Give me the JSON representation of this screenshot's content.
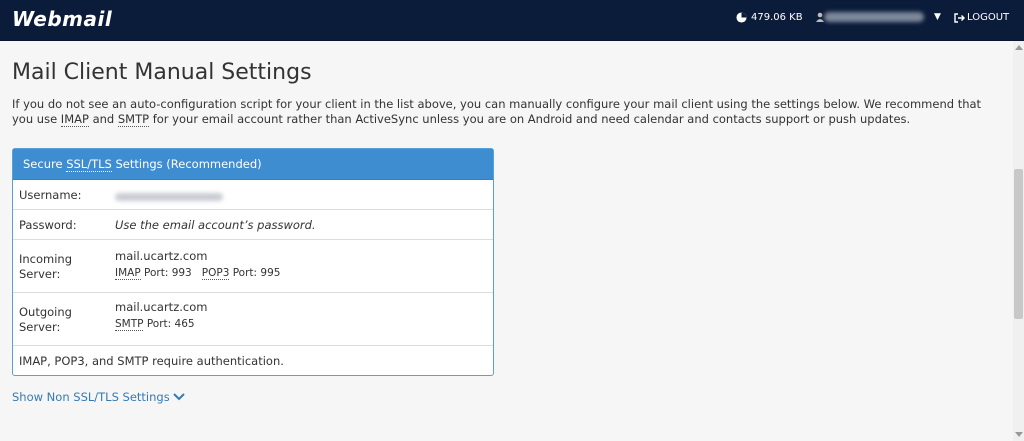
{
  "header": {
    "logo": "Webmail",
    "disk_usage": "479.06 KB",
    "logout_label": "LOGOUT"
  },
  "page": {
    "title": "Mail Client Manual Settings",
    "intro_part1": "If you do not see an auto-configuration script for your client in the list above, you can manually configure your mail client using the settings below. We recommend that you use ",
    "intro_imap": "IMAP",
    "intro_and": " and ",
    "intro_smtp": "SMTP",
    "intro_part2": " for your email account rather than ActiveSync unless you are on Android and need calendar and contacts support or push updates."
  },
  "panel": {
    "title_prefix": "Secure ",
    "title_ssl": "SSL/TLS",
    "title_suffix": " Settings (Recommended)",
    "username_label": "Username:",
    "password_label": "Password:",
    "password_value": "Use the email account’s password.",
    "incoming_label_1": "Incoming",
    "incoming_label_2": "Server:",
    "incoming_host": "mail.ucartz.com",
    "imap_label": "IMAP",
    "imap_port": " Port: 993",
    "pop3_label": "POP3",
    "pop3_port": " Port: 995",
    "outgoing_label_1": "Outgoing",
    "outgoing_label_2": "Server:",
    "outgoing_host": "mail.ucartz.com",
    "smtp_label": "SMTP",
    "smtp_port": " Port: 465",
    "auth_note": "IMAP, POP3, and SMTP require authentication."
  },
  "links": {
    "show_non_ssl": "Show Non SSL/TLS Settings"
  },
  "icons": {
    "disk": "pie-chart-icon",
    "user": "user-icon",
    "caret": "caret-down-icon",
    "logout": "logout-icon",
    "chevron": "chevron-down-icon"
  },
  "colors": {
    "topbar": "#0b1c3a",
    "panel_header": "#3f8dd1",
    "link": "#337ab7"
  }
}
